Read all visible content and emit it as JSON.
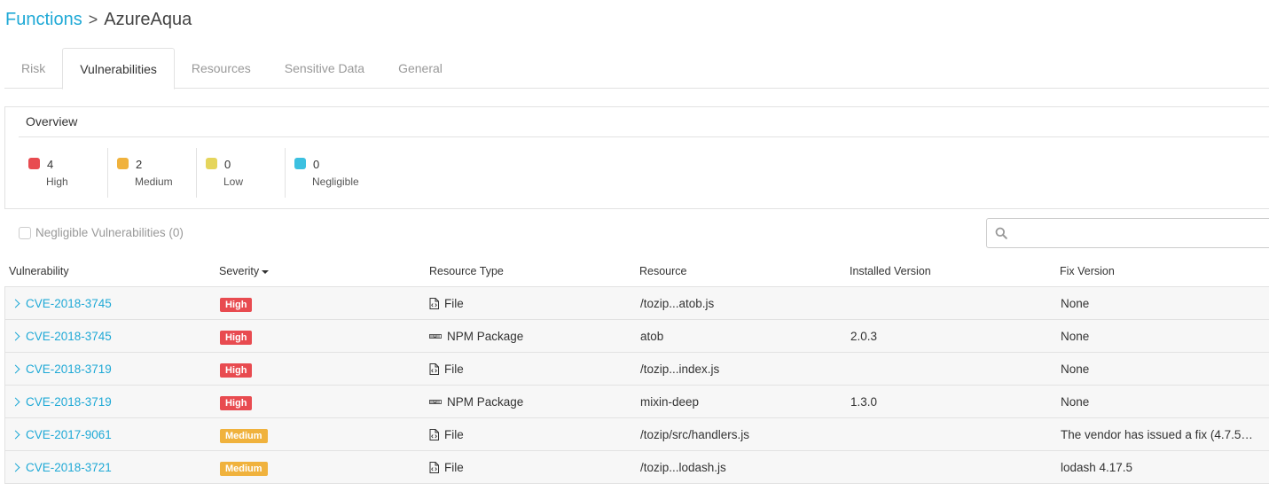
{
  "breadcrumb": {
    "parent": "Functions",
    "separator": ">",
    "current": "AzureAqua"
  },
  "tabs": [
    {
      "label": "Risk",
      "active": false
    },
    {
      "label": "Vulnerabilities",
      "active": true
    },
    {
      "label": "Resources",
      "active": false
    },
    {
      "label": "Sensitive Data",
      "active": false
    },
    {
      "label": "General",
      "active": false
    }
  ],
  "overview": {
    "title": "Overview",
    "stats": [
      {
        "count": "4",
        "label": "High",
        "color": "#e84b50"
      },
      {
        "count": "2",
        "label": "Medium",
        "color": "#f0b23d"
      },
      {
        "count": "0",
        "label": "Low",
        "color": "#e5d55c"
      },
      {
        "count": "0",
        "label": "Negligible",
        "color": "#3cc0e0"
      }
    ]
  },
  "filter": {
    "negligible_label": "Negligible Vulnerabilities (0)",
    "checked": false
  },
  "search": {
    "placeholder": "",
    "value": ""
  },
  "colors": {
    "accent": "#1fa9d6",
    "high": "#e84b50",
    "medium": "#f0b23d"
  },
  "table": {
    "columns": [
      "Vulnerability",
      "Severity",
      "Resource Type",
      "Resource",
      "Installed Version",
      "Fix Version"
    ],
    "sorted_by": "Severity",
    "rows": [
      {
        "vulnerability": "CVE-2018-3745",
        "severity": "High",
        "resource_type": "File",
        "resource_icon": "file-code-icon",
        "resource": "/tozip...atob.js",
        "installed_version": "",
        "fix_version": "None"
      },
      {
        "vulnerability": "CVE-2018-3745",
        "severity": "High",
        "resource_type": "NPM Package",
        "resource_icon": "npm-icon",
        "resource": "atob",
        "installed_version": "2.0.3",
        "fix_version": "None"
      },
      {
        "vulnerability": "CVE-2018-3719",
        "severity": "High",
        "resource_type": "File",
        "resource_icon": "file-code-icon",
        "resource": "/tozip...index.js",
        "installed_version": "",
        "fix_version": "None"
      },
      {
        "vulnerability": "CVE-2018-3719",
        "severity": "High",
        "resource_type": "NPM Package",
        "resource_icon": "npm-icon",
        "resource": "mixin-deep",
        "installed_version": "1.3.0",
        "fix_version": "None"
      },
      {
        "vulnerability": "CVE-2017-9061",
        "severity": "Medium",
        "resource_type": "File",
        "resource_icon": "file-code-icon",
        "resource": "/tozip/src/handlers.js",
        "installed_version": "",
        "fix_version": "The vendor has issued a fix (4.7.5…"
      },
      {
        "vulnerability": "CVE-2018-3721",
        "severity": "Medium",
        "resource_type": "File",
        "resource_icon": "file-code-icon",
        "resource": "/tozip...lodash.js",
        "installed_version": "",
        "fix_version": "lodash 4.17.5"
      }
    ]
  }
}
